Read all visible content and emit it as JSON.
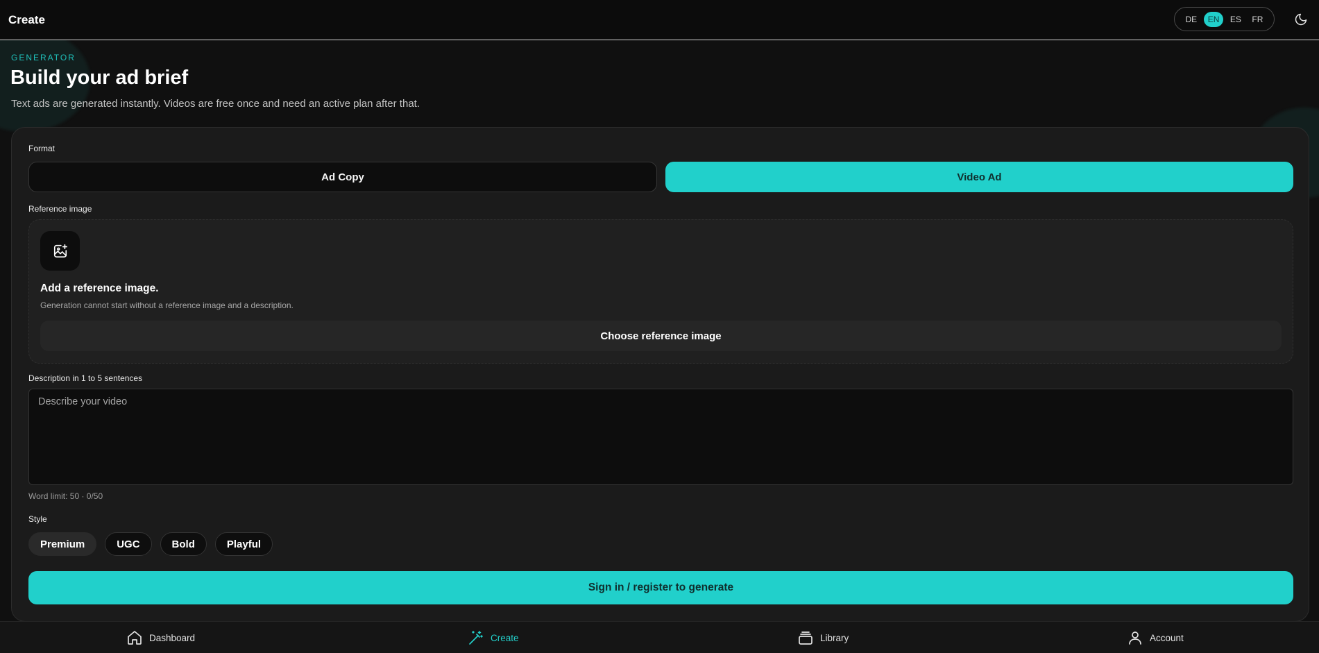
{
  "header": {
    "title": "Create",
    "languages": [
      "DE",
      "EN",
      "ES",
      "FR"
    ],
    "active_language": "EN",
    "theme_icon": "moon-icon"
  },
  "intro": {
    "eyebrow": "GENERATOR",
    "heading": "Build your ad brief",
    "subtitle": "Text ads are generated instantly. Videos are free once and need an active plan after that."
  },
  "form": {
    "format_label": "Format",
    "format_options": [
      "Ad Copy",
      "Video Ad"
    ],
    "format_selected": "Video Ad",
    "reference": {
      "label": "Reference image",
      "icon": "image-add-icon",
      "title": "Add a reference image.",
      "description": "Generation cannot start without a reference image and a description.",
      "button": "Choose reference image"
    },
    "description": {
      "label": "Description in 1 to 5 sentences",
      "placeholder": "Describe your video",
      "value": "",
      "word_limit": "Word limit: 50 · 0/50"
    },
    "style": {
      "label": "Style",
      "options": [
        "Premium",
        "UGC",
        "Bold",
        "Playful"
      ],
      "selected": "Premium"
    },
    "submit": "Sign in / register to generate"
  },
  "bottom_nav": {
    "items": [
      {
        "label": "Dashboard",
        "icon": "home-icon"
      },
      {
        "label": "Create",
        "icon": "magic-wand-icon"
      },
      {
        "label": "Library",
        "icon": "stack-icon"
      },
      {
        "label": "Account",
        "icon": "user-icon"
      }
    ],
    "active": "Create"
  },
  "colors": {
    "accent": "#21d0cb",
    "background": "#101010",
    "card": "#1b1b1b"
  }
}
